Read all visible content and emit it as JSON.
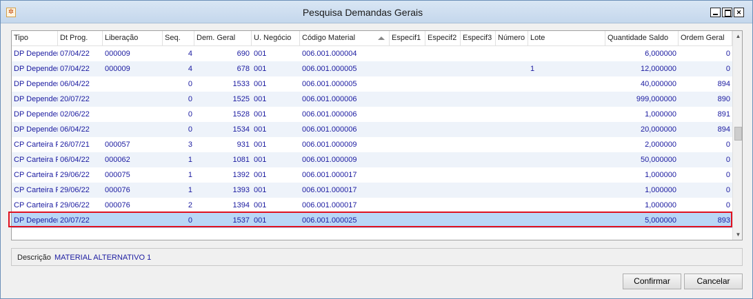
{
  "window": {
    "title": "Pesquisa Demandas Gerais",
    "app_icon": "app-logo-icon"
  },
  "grid": {
    "columns": [
      "Tipo",
      "Dt Prog.",
      "Liberação",
      "Seq.",
      "Dem. Geral",
      "U. Negócio",
      "Código Material",
      "Especif1",
      "Especif2",
      "Especif3",
      "Número",
      "Lote",
      "Quantidade Saldo",
      "Ordem Geral"
    ],
    "sorted_column": "Código Material",
    "rows": [
      [
        "DP Dependente",
        "07/04/22",
        "000009",
        "4",
        "690",
        "001",
        "006.001.000004",
        "",
        "",
        "",
        "",
        "",
        "6,000000",
        "0"
      ],
      [
        "DP Dependente",
        "07/04/22",
        "000009",
        "4",
        "678",
        "001",
        "006.001.000005",
        "",
        "",
        "",
        "",
        "1",
        "12,000000",
        "0"
      ],
      [
        "DP Dependente",
        "06/04/22",
        "",
        "0",
        "1533",
        "001",
        "006.001.000005",
        "",
        "",
        "",
        "",
        "",
        "40,000000",
        "894"
      ],
      [
        "DP Dependente",
        "20/07/22",
        "",
        "0",
        "1525",
        "001",
        "006.001.000006",
        "",
        "",
        "",
        "",
        "",
        "999,000000",
        "890"
      ],
      [
        "DP Dependente",
        "02/06/22",
        "",
        "0",
        "1528",
        "001",
        "006.001.000006",
        "",
        "",
        "",
        "",
        "",
        "1,000000",
        "891"
      ],
      [
        "DP Dependente",
        "06/04/22",
        "",
        "0",
        "1534",
        "001",
        "006.001.000006",
        "",
        "",
        "",
        "",
        "",
        "20,000000",
        "894"
      ],
      [
        "CP Carteira P",
        "26/07/21",
        "000057",
        "3",
        "931",
        "001",
        "006.001.000009",
        "",
        "",
        "",
        "",
        "",
        "2,000000",
        "0"
      ],
      [
        "CP Carteira P",
        "06/04/22",
        "000062",
        "1",
        "1081",
        "001",
        "006.001.000009",
        "",
        "",
        "",
        "",
        "",
        "50,000000",
        "0"
      ],
      [
        "CP Carteira P",
        "29/06/22",
        "000075",
        "1",
        "1392",
        "001",
        "006.001.000017",
        "",
        "",
        "",
        "",
        "",
        "1,000000",
        "0"
      ],
      [
        "CP Carteira P",
        "29/06/22",
        "000076",
        "1",
        "1393",
        "001",
        "006.001.000017",
        "",
        "",
        "",
        "",
        "",
        "1,000000",
        "0"
      ],
      [
        "CP Carteira P",
        "29/06/22",
        "000076",
        "2",
        "1394",
        "001",
        "006.001.000017",
        "",
        "",
        "",
        "",
        "",
        "1,000000",
        "0"
      ],
      [
        "DP Dependente",
        "20/07/22",
        "",
        "0",
        "1537",
        "001",
        "006.001.000025",
        "",
        "",
        "",
        "",
        "",
        "5,000000",
        "893"
      ]
    ],
    "selected_row_index": 11
  },
  "description": {
    "label": "Descrição",
    "value": "MATERIAL ALTERNATIVO 1"
  },
  "buttons": {
    "confirm": "Confirmar",
    "cancel": "Cancelar"
  },
  "colors": {
    "selection_outline": "#e0101e",
    "selected_row": "#b9d7f6",
    "cell_text": "#1a1aa0"
  }
}
